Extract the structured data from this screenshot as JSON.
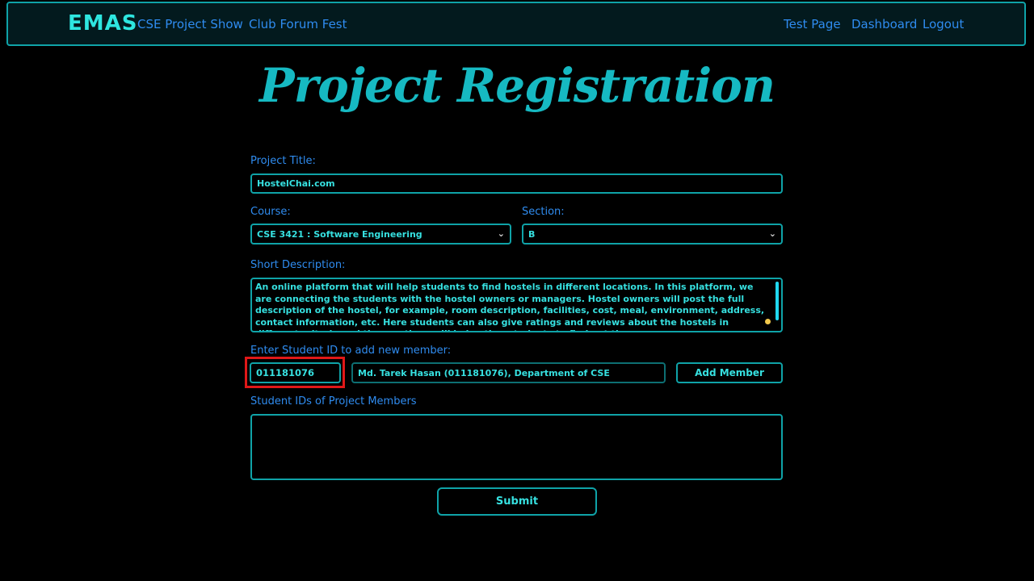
{
  "navbar": {
    "brand": "EMAS",
    "links_left": [
      "CSE Project Show",
      "Club Forum Fest"
    ],
    "links_right": [
      "Test Page",
      "Dashboard",
      "Logout"
    ]
  },
  "heading": "Project Registration",
  "form": {
    "project_title": {
      "label": "Project Title:",
      "value": "HostelChai.com"
    },
    "course": {
      "label": "Course:",
      "value": "CSE 3421 : Software Engineering"
    },
    "section": {
      "label": "Section:",
      "value": "B"
    },
    "description": {
      "label": "Short Description:",
      "value": "An online platform that will help students to find hostels in different locations. In this platform, we are connecting the students with the hostel owners or managers. Hostel owners will post the full description of the hostel, for example, room description, facilities, cost, meal, environment, address, contact information, etc. Here students can also give ratings and reviews about the hostels in different criteria and these ratings will help other students to find out the"
    },
    "add_member": {
      "label": "Enter Student ID to add new member:",
      "student_id_value": "011181076",
      "student_info_value": "Md. Tarek Hasan (011181076), Department of CSE",
      "button_label": "Add Member"
    },
    "members": {
      "label": "Student IDs of Project Members",
      "value": ""
    },
    "submit_label": "Submit"
  },
  "colors": {
    "background": "#000000",
    "accent": "#0fa3a8",
    "label": "#2f8cf0",
    "field_text": "#36e0e0",
    "highlight": "#e01818"
  }
}
